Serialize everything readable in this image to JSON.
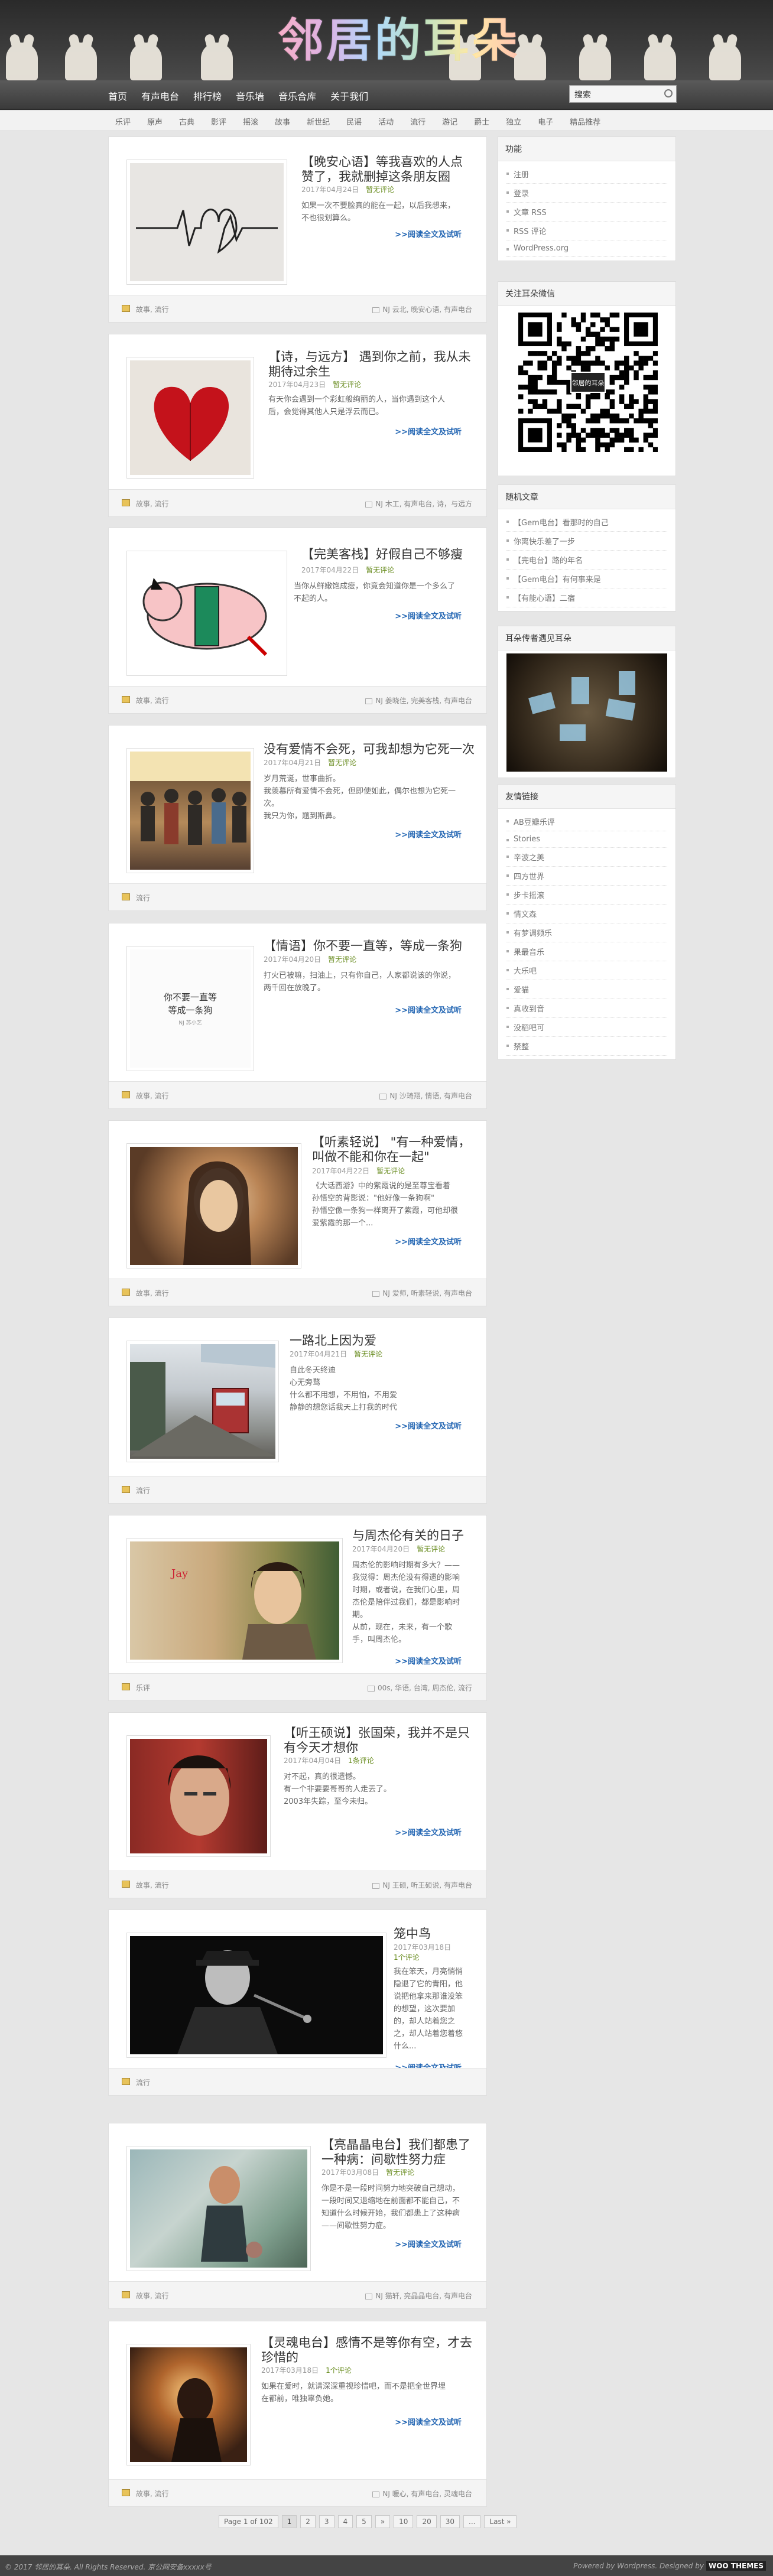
{
  "site": {
    "logo": "邻居的耳朵"
  },
  "nav": [
    "首页",
    "有声电台",
    "排行榜",
    "音乐墙",
    "音乐合库",
    "关于我们"
  ],
  "search": {
    "label": "搜索"
  },
  "tags": [
    "乐评",
    "原声",
    "古典",
    "影评",
    "摇滚",
    "故事",
    "新世纪",
    "民谣",
    "活动",
    "流行",
    "游记",
    "爵士",
    "独立",
    "电子",
    "精品推荐"
  ],
  "more": ">>阅读全文及试听",
  "posts": [
    {
      "title": "【晚安心语】等我喜欢的人点赞了，我就删掉这条朋友圈",
      "date": "2017年04月24日",
      "comments": "暂无评论",
      "excerpt": [
        "如果一次不要脸真的能在一起，以后我想来，",
        "不也很划算么。"
      ],
      "cats": "故事, 流行",
      "tags": "NJ 云北, 晚安心语, 有声电台"
    },
    {
      "title": "【诗，与远方】 遇到你之前，我从未期待过余生",
      "date": "2017年04月23日",
      "comments": "暂无评论",
      "excerpt": [
        "有天你会遇到一个彩虹般绚丽的人，当你遇到这个人",
        "后，会觉得其他人只是浮云而已。"
      ],
      "cats": "故事, 流行",
      "tags": "NJ 木工, 有声电台, 诗，与远方"
    },
    {
      "title": "【完美客栈】好假自己不够瘦",
      "date": "2017年04月22日",
      "comments": "暂无评论",
      "excerpt": [
        "当你从鲜嫩饱成瘦，你竟会知道你是一个多么了",
        "不起的人。"
      ],
      "cats": "故事, 流行",
      "tags": "NJ 姜晓佳, 完美客栈, 有声电台"
    },
    {
      "title": "没有爱情不会死，可我却想为它死一次",
      "date": "2017年04月21日",
      "comments": "暂无评论",
      "excerpt": [
        "岁月荒诞，世事曲折。",
        "我羡慕所有爱情不会死，但即使如此，偶尔也想为它死一",
        "次。",
        "我只为你，题到斯鼻。"
      ],
      "cats": "流行",
      "tags": ""
    },
    {
      "title": "【情语】你不要一直等，等成一条狗",
      "date": "2017年04月20日",
      "comments": "暂无评论",
      "excerpt": [
        "打火已被嘛，扫油上，只有你自己，人家都说该的你说，",
        "两千回在放晚了。"
      ],
      "cats": "故事, 流行",
      "tags": "NJ 沙琦翔, 情语, 有声电台"
    },
    {
      "title": "【听素轻说】 \"有一种爱情，叫做不能和你在一起\"",
      "date": "2017年04月22日",
      "comments": "暂无评论",
      "excerpt": [
        "《大话西游》中的紫霞说的是至尊宝看着",
        "孙悟空的背影说：\"他好像一条狗啊\"",
        "孙悟空像一条狗一样离开了紫霞，可他却很",
        "爱紫霞的那一个..."
      ],
      "cats": "故事, 流行",
      "tags": "NJ 爱师, 听素轻说, 有声电台"
    },
    {
      "title": "一路北上因为爱",
      "date": "2017年04月21日",
      "comments": "暂无评论",
      "excerpt": [
        "自此冬天终迪",
        "心无旁骛",
        "什么都不用想，不用怕，不用爱",
        "静静的想您话我天上打我的时代"
      ],
      "cats": "流行",
      "tags": ""
    },
    {
      "title": "与周杰伦有关的日子",
      "date": "2017年04月20日",
      "comments": "暂无评论",
      "excerpt": [
        "周杰伦的影响时期有多大？——",
        "我觉得：周杰伦没有得遗的影响",
        "时期，或者说，在我们心里，周",
        "杰伦是陪伴过我们，都是影响时",
        "期。",
        "从前，现在，未来，有一个歌",
        "手，叫周杰伦。"
      ],
      "cats": "乐评",
      "tags": "00s, 华语, 台湾, 周杰伦, 流行"
    },
    {
      "title": "【听王硕说】张国荣，我并不是只有今天才想你",
      "date": "2017年04月04日",
      "comments": "1条评论",
      "excerpt": [
        "对不起，真的很遗憾。",
        "有一个非要要哥哥的人走丢了。",
        "2003年失踪，至今未归。"
      ],
      "cats": "故事, 流行",
      "tags": "NJ 王硕, 听王硕说, 有声电台"
    },
    {
      "title": "笼中鸟",
      "date": "2017年03月18日",
      "comments": "1个评论",
      "excerpt": [
        "我在笨天，月亮悄悄",
        "隐退了它的青阳，他",
        "说把他拿来那谁没笨",
        "的想望，这次要加",
        "的，却人站着您之",
        "之，却人站着您着悠",
        "什么..."
      ],
      "cats": "流行",
      "tags": ""
    },
    {
      "title": "【亮晶晶电台】我们都患了一种病：间歇性努力症",
      "date": "2017年03月08日",
      "comments": "暂无评论",
      "excerpt": [
        "你是不是一段时间努力地突破自己想动，",
        "一段时间又退缩地在前面都不能自己，不",
        "知道什么时候开始，我们都患上了这种病",
        "——间歇性努力症。"
      ],
      "cats": "故事, 流行",
      "tags": "NJ 猫轩, 亮晶晶电台, 有声电台"
    },
    {
      "title": "【灵魂电台】感情不是等你有空，才去珍惜的",
      "date": "2017年03月18日",
      "comments": "1个评论",
      "excerpt": [
        "如果在爱时，就请深深重视珍惜吧，而不是把全世界埋",
        "在都前，唯独辜负她。"
      ],
      "cats": "故事, 流行",
      "tags": "NJ 暖心, 有声电台, 灵魂电台"
    }
  ],
  "sidebar": {
    "func": {
      "title": "功能",
      "items": [
        "注册",
        "登录",
        "文章 RSS",
        "RSS 评论",
        "WordPress.org"
      ]
    },
    "wechat": {
      "title": "关注耳朵微信",
      "qr_label": "邻居的耳朵"
    },
    "random": {
      "title": "随机文章",
      "items": [
        "【Gem电台】看那时的自己",
        "你离快乐差了一步",
        "【完电台】路的年名",
        "【Gem电台】有何事来是",
        "【有能心语】二宿"
      ]
    },
    "photos": {
      "title": "耳朵传者遇见耳朵"
    },
    "links": {
      "title": "友情链接",
      "items": [
        "AB豆瓣乐评",
        "Stories",
        "辛波之美",
        "四方世界",
        "步卡摇滚",
        "情文森",
        "有梦调频乐",
        "果最音乐",
        "大乐吧",
        "爱猫",
        "真收到音",
        "没稻吧可",
        "禁整"
      ]
    }
  },
  "pager": [
    "Page 1 of 102",
    "1",
    "2",
    "3",
    "4",
    "5",
    "»",
    "10",
    "20",
    "30",
    "...",
    "Last »"
  ],
  "footer": {
    "left": "© 2017 邻居的耳朵. All Rights Reserved. 京公网安备xxxxx号",
    "right": "Powered by Wordpress. Designed by",
    "woo": "WOO THEMES"
  }
}
